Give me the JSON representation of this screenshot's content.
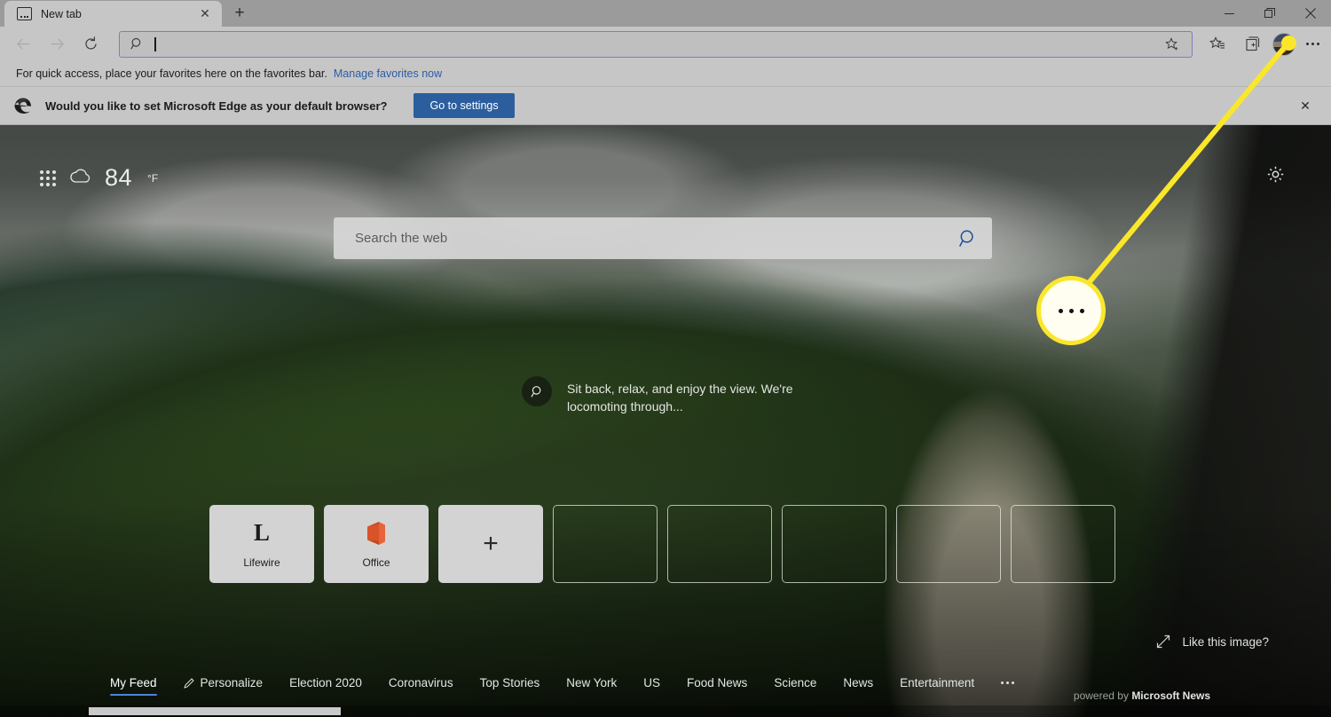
{
  "window": {
    "minimize_label": "Minimize",
    "restore_label": "Restore",
    "close_label": "Close"
  },
  "tabs": [
    {
      "title": "New tab",
      "favicon": "new-tab-icon",
      "close_label": "✕"
    }
  ],
  "new_tab_button": "+",
  "toolbar": {
    "back_label": "Back",
    "forward_label": "Forward",
    "refresh_label": "Refresh",
    "address": {
      "value": "",
      "placeholder": "",
      "search_icon": "search-icon",
      "favorite_icon": "star-icon"
    },
    "favorites_icon": "favorites-list-icon",
    "collections_icon": "collections-icon",
    "profile_icon": "avatar",
    "settings_more_icon": "ellipsis-icon"
  },
  "favorites_bar": {
    "message": "For quick access, place your favorites here on the favorites bar.",
    "link": "Manage favorites now"
  },
  "banner": {
    "icon": "edge-logo-icon",
    "message": "Would you like to set Microsoft Edge as your default browser?",
    "button": "Go to settings",
    "close": "✕"
  },
  "newtab": {
    "app_grid_icon": "app-grid-icon",
    "weather": {
      "icon": "cloud-icon",
      "temperature": "84",
      "unit": "°F"
    },
    "page_settings_icon": "gear-icon",
    "search": {
      "placeholder": "Search the web",
      "value": "",
      "icon": "search-icon"
    },
    "image_caption": {
      "badge_icon": "magnifier-icon",
      "text": "Sit back, relax, and enjoy the view. We're locomoting through..."
    },
    "tiles": [
      {
        "label": "Lifewire",
        "icon": "lifewire-icon",
        "kind": "filled"
      },
      {
        "label": "Office",
        "icon": "office-icon",
        "kind": "filled"
      },
      {
        "label": "",
        "icon": "plus-icon",
        "kind": "add"
      },
      {
        "label": "",
        "icon": "",
        "kind": "empty"
      },
      {
        "label": "",
        "icon": "",
        "kind": "empty"
      },
      {
        "label": "",
        "icon": "",
        "kind": "empty"
      },
      {
        "label": "",
        "icon": "",
        "kind": "empty"
      },
      {
        "label": "",
        "icon": "",
        "kind": "empty"
      }
    ],
    "like_image": {
      "icon": "expand-icon",
      "label": "Like this image?"
    },
    "feed_nav": {
      "items": [
        {
          "label": "My Feed",
          "active": true,
          "icon": ""
        },
        {
          "label": "Personalize",
          "active": false,
          "icon": "pencil-icon"
        },
        {
          "label": "Election 2020",
          "active": false,
          "icon": ""
        },
        {
          "label": "Coronavirus",
          "active": false,
          "icon": ""
        },
        {
          "label": "Top Stories",
          "active": false,
          "icon": ""
        },
        {
          "label": "New York",
          "active": false,
          "icon": ""
        },
        {
          "label": "US",
          "active": false,
          "icon": ""
        },
        {
          "label": "Food News",
          "active": false,
          "icon": ""
        },
        {
          "label": "Science",
          "active": false,
          "icon": ""
        },
        {
          "label": "News",
          "active": false,
          "icon": ""
        },
        {
          "label": "Entertainment",
          "active": false,
          "icon": ""
        }
      ],
      "more_icon": "ellipsis-icon"
    },
    "powered_by": {
      "prefix": "powered by",
      "brand": "Microsoft News"
    }
  },
  "annotation": {
    "bubble_icon": "ellipsis-icon",
    "highlight_color": "#fbe72a"
  }
}
